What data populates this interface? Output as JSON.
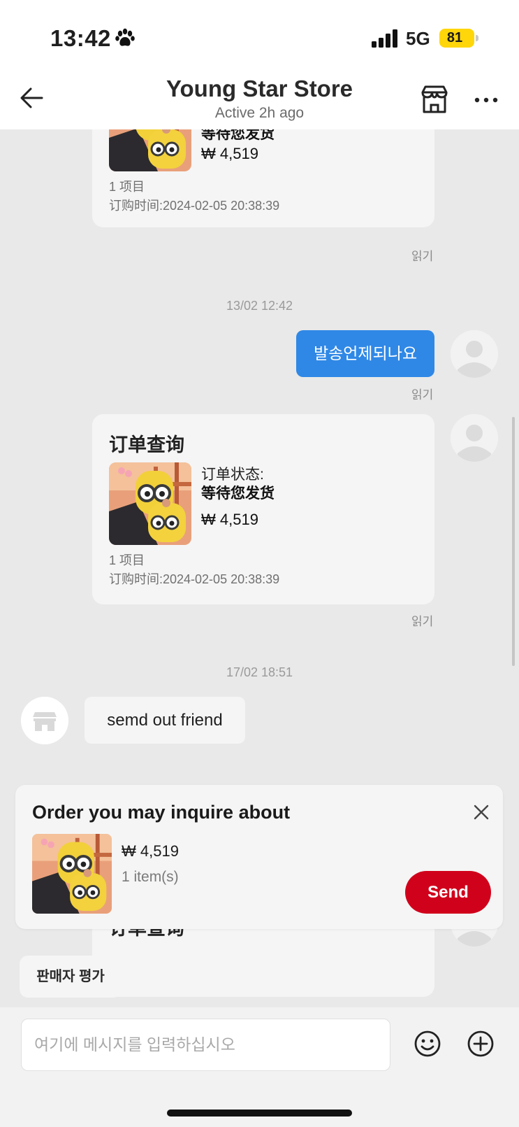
{
  "status_bar": {
    "time": "13:42",
    "network": "5G",
    "battery": "81"
  },
  "header": {
    "title": "Young Star Store",
    "subtitle": "Active 2h ago"
  },
  "messages": {
    "card1": {
      "status_value": "等待您发货",
      "price": "₩ 4,519",
      "items": "1 项目",
      "order_time": "订购时间:2024-02-05 20:38:39",
      "read": "읽기"
    },
    "timestamp1": "13/02 12:42",
    "bubble_me": {
      "text": "발송언제되나요",
      "read": "읽기"
    },
    "card2": {
      "title": "订单查询",
      "status_label": "订单状态:",
      "status_value": "等待您发货",
      "price": "₩ 4,519",
      "items": "1 项目",
      "order_time": "订购时间:2024-02-05 20:38:39",
      "read": "읽기"
    },
    "timestamp2": "17/02 18:51",
    "bubble_them": {
      "text": "semd out friend"
    },
    "card3": {
      "title": "订单查询"
    }
  },
  "suggestion": {
    "title": "Order you may inquire about",
    "price": "₩ 4,519",
    "items": "1 item(s)",
    "send_label": "Send"
  },
  "rate_chip": {
    "label": "판매자 평가"
  },
  "composer": {
    "placeholder": "여기에 메시지를 입력하십시오"
  },
  "colors": {
    "accent_blue": "#2f88e6",
    "send_red": "#d0021b",
    "battery_yellow": "#ffd60a"
  },
  "icons": [
    "paw-icon",
    "signal-icon",
    "back-arrow-icon",
    "store-icon",
    "more-icon",
    "avatar-icon",
    "store-avatar-icon",
    "close-icon",
    "emoji-icon",
    "plus-icon"
  ]
}
